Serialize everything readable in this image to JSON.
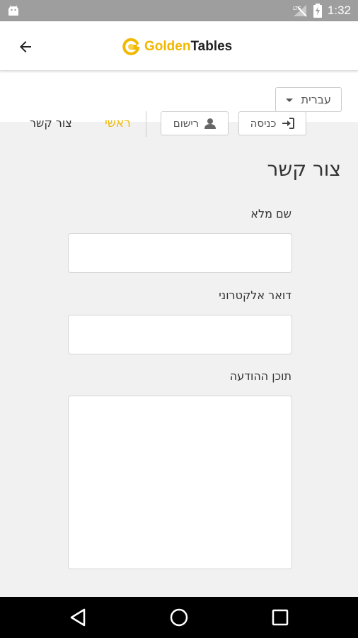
{
  "status_bar": {
    "time": "1:32",
    "icons": [
      "android-icon",
      "signal-icon",
      "battery-charging-icon"
    ]
  },
  "app_bar": {
    "logo_part1": "Golden",
    "logo_part2": "Tables",
    "brand_color": "#f2b800"
  },
  "language_select": {
    "selected": "עברית"
  },
  "nav": {
    "contact": "צור קשר",
    "main": "ראשי",
    "register": "רישום",
    "login": "כניסה"
  },
  "form": {
    "title": "צור קשר",
    "full_name_label": "שם מלא",
    "email_label": "דואר אלקטרוני",
    "message_label": "תוכן ההודעה"
  }
}
